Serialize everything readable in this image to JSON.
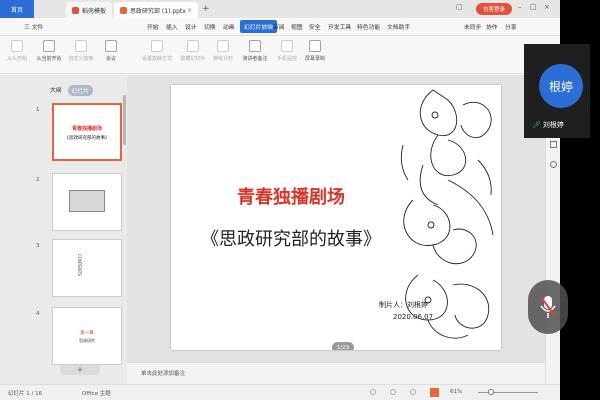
{
  "tabs": {
    "home": "首页",
    "templates": "稻壳模板",
    "document": "思政研究部 (1).pptx"
  },
  "login_label": "访客登录",
  "menu": {
    "file": "三 文件",
    "items": [
      "开始",
      "插入",
      "设计",
      "切换",
      "动画",
      "幻灯片放映",
      "审阅",
      "视图",
      "安全",
      "开发工具",
      "特色功能",
      "文档助手"
    ],
    "active_index": 5,
    "sync": "未同步",
    "collab": "协作",
    "share": "分享"
  },
  "ribbon": {
    "buttons": [
      {
        "label": "从头开始",
        "dim": true
      },
      {
        "label": "从当前开始",
        "dim": false
      },
      {
        "label": "自定义放映",
        "dim": true
      },
      {
        "label": "会议",
        "dim": false
      },
      {
        "label": "设置放映方式",
        "dim": true
      },
      {
        "label": "隐藏幻灯片",
        "dim": true
      },
      {
        "label": "排练计时",
        "dim": true
      },
      {
        "label": "演讲者备注",
        "dim": false
      },
      {
        "label": "手机遥控",
        "dim": true
      },
      {
        "label": "屏幕录制",
        "dim": false
      }
    ]
  },
  "sidebar": {
    "outline_tab": "大纲",
    "slides_tab": "幻灯片",
    "thumbnails": [
      {
        "num": "1",
        "title": "青春独播剧场",
        "sub": "《思政研究部的故事》"
      },
      {
        "num": "2",
        "title": "",
        "sub": ""
      },
      {
        "num": "3",
        "title": "CONTENTS",
        "sub": ""
      },
      {
        "num": "4",
        "title": "第一章",
        "sub": "思政研究"
      }
    ]
  },
  "slide": {
    "title": "青春独播剧场",
    "subtitle": "《思政研究部的故事》",
    "maker": "制片人：刘根婷",
    "date": "2020.06.07",
    "page": "1/23"
  },
  "notes_placeholder": "单击此处添加备注",
  "status": {
    "slide_info": "幻灯片 1 / 16",
    "theme": "Office 主题",
    "zoom": "61%"
  },
  "video": {
    "avatar_text": "根婷",
    "name": "刘根婷"
  },
  "colors": {
    "accent": "#2b6fd6",
    "title_red": "#d9362b",
    "selection": "#e8643c"
  }
}
